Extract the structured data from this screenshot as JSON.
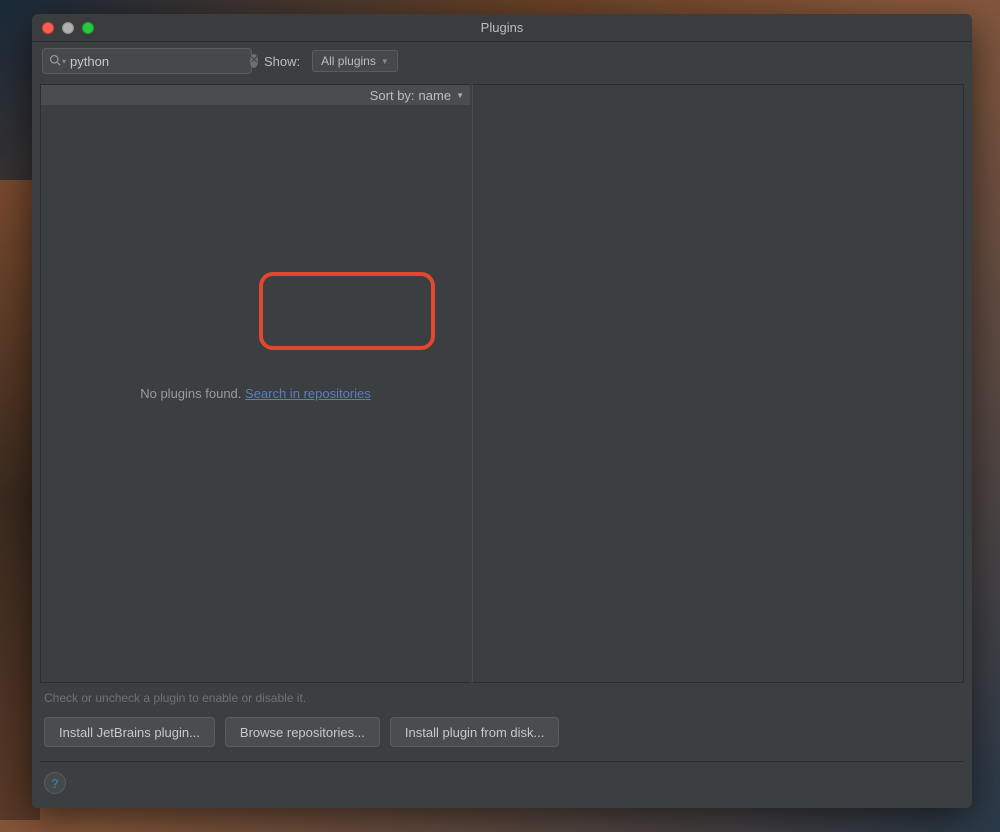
{
  "titlebar": {
    "title": "Plugins"
  },
  "toolbar": {
    "search_value": "python",
    "show_label": "Show:",
    "show_dropdown": "All plugins"
  },
  "list": {
    "sort_label": "Sort by:",
    "sort_value": "name",
    "empty_message": "No plugins found.",
    "search_link": "Search in repositories"
  },
  "hint": "Check or uncheck a plugin to enable or disable it.",
  "buttons": {
    "install_jetbrains": "Install JetBrains plugin...",
    "browse_repos": "Browse repositories...",
    "install_from_disk": "Install plugin from disk..."
  },
  "footer": {
    "help_symbol": "?"
  }
}
